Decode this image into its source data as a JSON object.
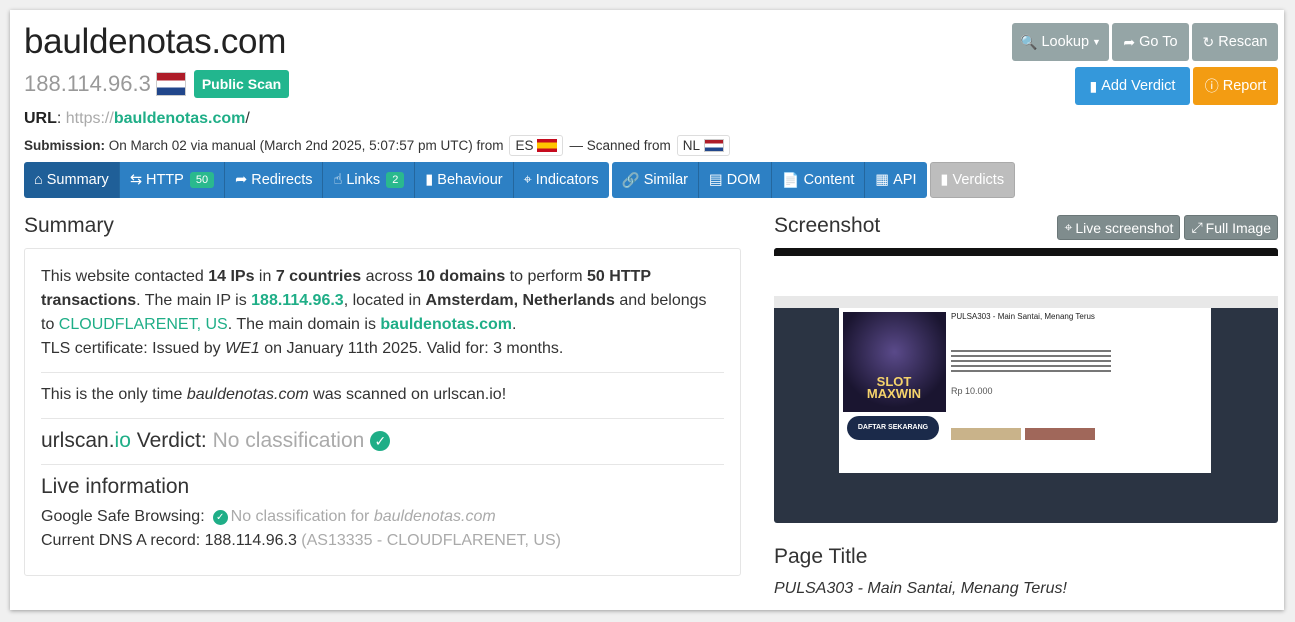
{
  "header": {
    "domain": "bauldenotas.com",
    "ip": "188.114.96.3",
    "badge": "Public Scan",
    "url_label": "URL",
    "url_scheme": "https://",
    "url_host": "bauldenotas.com",
    "url_path": "/",
    "submission_label": "Submission:",
    "submission_text": "On March 02 via manual (March 2nd 2025, 5:07:57 pm UTC) from",
    "submitted_country": "ES",
    "scanned_from_text": "— Scanned from",
    "scanned_country": "NL"
  },
  "actions": {
    "lookup": "Lookup",
    "goto": "Go To",
    "rescan": "Rescan",
    "add_verdict": "Add Verdict",
    "report": "Report"
  },
  "tabs": [
    {
      "label": "Summary"
    },
    {
      "label": "HTTP",
      "count": "50"
    },
    {
      "label": "Redirects"
    },
    {
      "label": "Links",
      "count": "2"
    },
    {
      "label": "Behaviour"
    },
    {
      "label": "Indicators"
    },
    {
      "label": "Similar"
    },
    {
      "label": "DOM"
    },
    {
      "label": "Content"
    },
    {
      "label": "API"
    },
    {
      "label": "Verdicts"
    }
  ],
  "summary": {
    "heading": "Summary",
    "p1": {
      "t1": "This website contacted ",
      "ips": "14 IPs",
      "t2": " in ",
      "countries": "7 countries",
      "t3": " across ",
      "domains": "10 domains",
      "t4": " to perform ",
      "transactions": "50 HTTP transactions",
      "t5": ". The main IP is ",
      "main_ip": "188.114.96.3",
      "t6": ", located in ",
      "location": "Amsterdam, Netherlands",
      "t7": " and belongs to ",
      "asn": "CLOUDFLARENET, US",
      "t8": ". The main domain is ",
      "main_domain": "bauldenotas.com",
      "t9": "."
    },
    "tls": {
      "t1": "TLS certificate: Issued by ",
      "issuer": "WE1",
      "t2": " on January 11th 2025. Valid for: 3 months."
    },
    "only": {
      "t1": "This is the only time ",
      "domain": "bauldenotas.com",
      "t2": " was scanned on urlscan.io!"
    },
    "verdict": {
      "brand1": "urlscan.",
      "brand2": "io",
      "label": " Verdict: ",
      "value": "No classification"
    },
    "live": {
      "heading": "Live information",
      "gsb_label": "Google Safe Browsing:",
      "gsb_value": "No classification for ",
      "gsb_domain": "bauldenotas.com",
      "dns_label": "Current DNS A record: 188.114.96.3",
      "dns_extra": " (AS13335 - CLOUDFLARENET, US)"
    }
  },
  "screenshot": {
    "heading": "Screenshot",
    "live_btn": "Live screenshot",
    "full_btn": "Full Image",
    "site_title": "PULSA303 - Main Santai, Menang Terus",
    "slot_text": "SLOT MAXWIN",
    "daftar": "DAFTAR SEKARANG",
    "price": "Rp 10.000"
  },
  "page_title": {
    "heading": "Page Title",
    "value": "PULSA303 - Main Santai, Menang Terus!"
  }
}
